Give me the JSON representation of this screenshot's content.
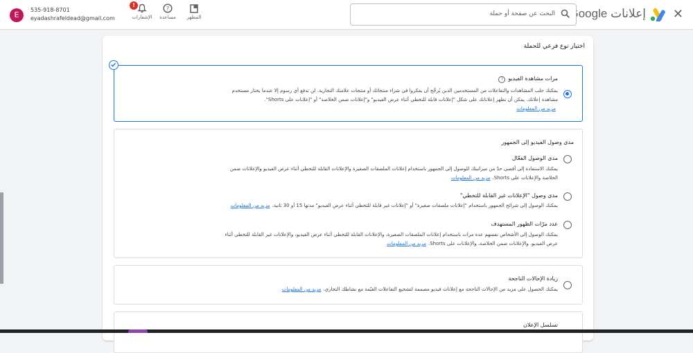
{
  "header": {
    "close_icon": "close-icon",
    "brand_google": "Google",
    "brand_ads": "إعلانات",
    "search_placeholder": "البحث عن صفحة أو حملة",
    "tools": [
      {
        "label": "المظهر",
        "icon": "appearance-icon"
      },
      {
        "label": "مساعدة",
        "icon": "help-icon"
      },
      {
        "label": "الإشعارات",
        "icon": "bell-icon",
        "badge": "!"
      }
    ],
    "account": {
      "initial": "E",
      "phone": "535-918-8701",
      "email": "eyadashrafeldead@gmail.com"
    },
    "colors": {
      "brand_blue": "#1a73e8",
      "avatar": "#c2185b",
      "badge": "#d93025"
    }
  },
  "main": {
    "title": "اختيار نوع فرعي للحملة",
    "options": [
      {
        "title": "مرات مشاهدة الفيديو",
        "selected": true,
        "line1": "يمكنك جلب المشاهدات والتفاعلات من المستخدمين الذين يُرجَّح أن يفكروا في شراء منتجاتك أو منتجات علامتك التجارية. لن تدفع أي رسوم إلا عندما يختار مستخدم",
        "line2": "مشاهدة إعلانك. يمكن أن تظهر إعلاناتك على شكل \"إعلانات قابلة للتخطي أثناء عرض الفيديو\" و\"إعلانات ضمن الخلاصة\" أو \"إعلانات على Shorts\".",
        "link": "مزيد من المعلومات"
      }
    ],
    "reach_group": {
      "title": "مدى وصول الفيديو إلى الجمهور",
      "items": [
        {
          "title": "مدى الوصول الفعّال",
          "line1": "يمكنك الاستفادة إلى أقصى حدّ من ميزانيتك للوصول إلى الجمهور باستخدام إعلانات الملصقات الصغيرة والإعلانات القابلة للتخطي أثناء عرض الفيديو والإعلانات ضمن",
          "line2": "الخلاصة والإعلانات على Shorts.",
          "link": "مزيد من المعلومات"
        },
        {
          "title": "مدى وصول \"الإعلانات غير القابلة للتخطي\"",
          "line1": "يمكنك الوصول إلى شرائح الجمهور باستخدام \"إعلانات ملصقات صغيرة\" أو \"إعلانات غير قابلة للتخطي أثناء عرض الفيديو\" مدتها 15 أو 30 ثانية.",
          "link": "مزيد من المعلومات"
        },
        {
          "title": "عدد مرّات الظهور المستهدف",
          "line1": "يمكنك الوصول إلى الأشخاص نفسهم عدة مرات باستخدام إعلانات الملصقات الصغيرة، والإعلانات القابلة للتخطي أثناء عرض الفيديو، والإعلانات غير القابلة للتخطي أثناء",
          "line2": "عرض الفيديو، والإعلانات ضمن الخلاصة، والإعلانات على Shorts.",
          "link": "مزيد من المعلومات"
        }
      ]
    },
    "conversions": {
      "title": "زيادة الإحالات الناجحة",
      "line1": "يمكنك الحصول على مزيد من الإحالات الناجحة مع إعلانات فيديو مصممة لتشجيع التفاعلات القيّمة مع نشاطك التجاري.",
      "link": "مزيد من المعلومات"
    },
    "sequence": {
      "title": "تسلسل الإعلان"
    }
  }
}
